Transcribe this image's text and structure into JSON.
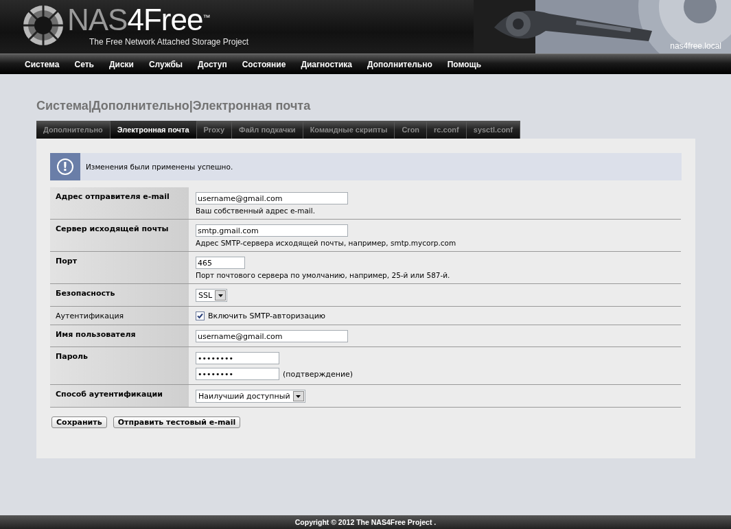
{
  "header": {
    "logo": {
      "part_1": "NAS",
      "part_2": "4Free",
      "trademark": "™",
      "tagline": "The Free Network Attached Storage Project"
    },
    "hostname": "nas4free.local"
  },
  "nav": [
    "Система",
    "Сеть",
    "Диски",
    "Службы",
    "Доступ",
    "Состояние",
    "Диагностика",
    "Дополнительно",
    "Помощь"
  ],
  "page_title": "Система|Дополнительно|Электронная почта",
  "tabs": [
    {
      "label": "Дополнительно",
      "selected": false
    },
    {
      "label": "Электронная почта",
      "selected": true
    },
    {
      "label": "Proxy",
      "selected": false
    },
    {
      "label": "Файл подкачки",
      "selected": false
    },
    {
      "label": "Командные скрипты",
      "selected": false
    },
    {
      "label": "Cron",
      "selected": false
    },
    {
      "label": "rc.conf",
      "selected": false
    },
    {
      "label": "sysctl.conf",
      "selected": false
    }
  ],
  "message": {
    "icon": "!",
    "text": "Изменения были применены успешно."
  },
  "rows": [
    {
      "kind": "text",
      "label": "Адрес отправителя e-mail",
      "value": "username@gmail.com",
      "hint": "Ваш собственный адрес e-mail."
    },
    {
      "kind": "text",
      "label": "Сервер исходящей почты",
      "value": "smtp.gmail.com",
      "hint": "Адрес SMTP-сервера исходящей почты, например, smtp.mycorp.com"
    },
    {
      "kind": "number",
      "label": "Порт",
      "value": "465",
      "hint": "Порт почтового сервера по умолчанию, например, 25-й или 587-й."
    },
    {
      "kind": "select",
      "label": "Безопасность",
      "value": "SSL"
    },
    {
      "kind": "checkbox",
      "label": "Аутентификация",
      "checked": true,
      "caption": "Включить SMTP-авторизацию"
    },
    {
      "kind": "text",
      "label": "Имя пользователя",
      "value": "username@gmail.com"
    },
    {
      "kind": "password",
      "label": "Пароль",
      "value": "••••••••",
      "confirm_value": "••••••••",
      "confirm_caption": "(подтверждение)"
    },
    {
      "kind": "select",
      "label": "Способ аутентификации",
      "value": "Наилучший доступный"
    }
  ],
  "buttons": [
    "Сохранить",
    "Отправить тестовый e-mail"
  ],
  "footer": "Copyright © 2012 The NAS4Free Project ."
}
